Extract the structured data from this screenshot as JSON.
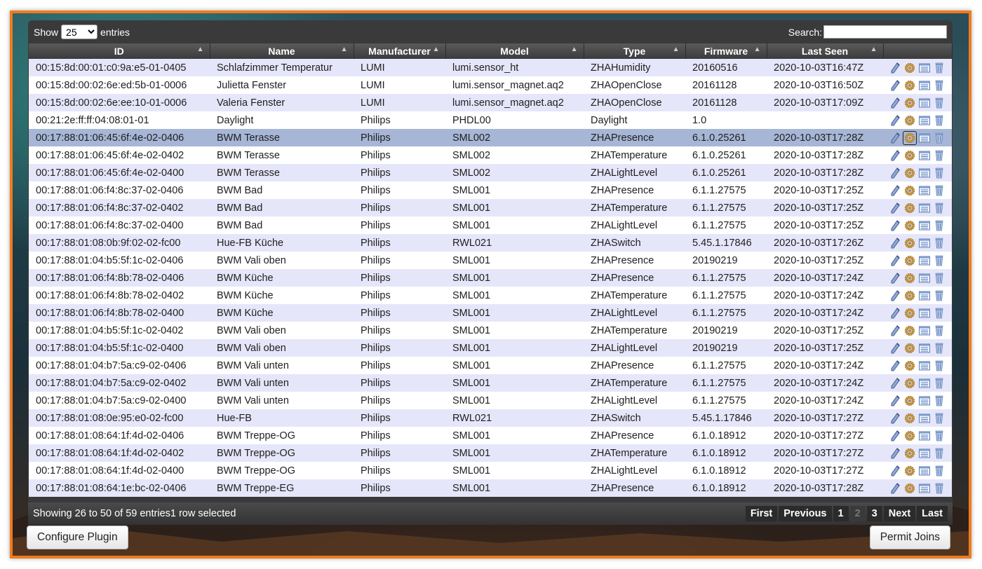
{
  "toolbar": {
    "show_label": "Show",
    "entries_value": "25",
    "entries_label": "entries",
    "search_label": "Search:",
    "search_value": ""
  },
  "columns": [
    "ID",
    "Name",
    "Manufacturer",
    "Model",
    "Type",
    "Firmware",
    "Last Seen",
    ""
  ],
  "rows": [
    [
      "00:15:8d:00:01:c0:9a:e5-01-0405",
      "Schlafzimmer Temperatur",
      "LUMI",
      "lumi.sensor_ht",
      "ZHAHumidity",
      "20160516",
      "2020-10-03T16:47Z"
    ],
    [
      "00:15:8d:00:02:6e:ed:5b-01-0006",
      "Julietta Fenster",
      "LUMI",
      "lumi.sensor_magnet.aq2",
      "ZHAOpenClose",
      "20161128",
      "2020-10-03T16:50Z"
    ],
    [
      "00:15:8d:00:02:6e:ee:10-01-0006",
      "Valeria Fenster",
      "LUMI",
      "lumi.sensor_magnet.aq2",
      "ZHAOpenClose",
      "20161128",
      "2020-10-03T17:09Z"
    ],
    [
      "00:21:2e:ff:ff:04:08:01-01",
      "Daylight",
      "Philips",
      "PHDL00",
      "Daylight",
      "1.0",
      ""
    ],
    [
      "00:17:88:01:06:45:6f:4e-02-0406",
      "BWM Terasse",
      "Philips",
      "SML002",
      "ZHAPresence",
      "6.1.0.25261",
      "2020-10-03T17:28Z"
    ],
    [
      "00:17:88:01:06:45:6f:4e-02-0402",
      "BWM Terasse",
      "Philips",
      "SML002",
      "ZHATemperature",
      "6.1.0.25261",
      "2020-10-03T17:28Z"
    ],
    [
      "00:17:88:01:06:45:6f:4e-02-0400",
      "BWM Terasse",
      "Philips",
      "SML002",
      "ZHALightLevel",
      "6.1.0.25261",
      "2020-10-03T17:28Z"
    ],
    [
      "00:17:88:01:06:f4:8c:37-02-0406",
      "BWM Bad",
      "Philips",
      "SML001",
      "ZHAPresence",
      "6.1.1.27575",
      "2020-10-03T17:25Z"
    ],
    [
      "00:17:88:01:06:f4:8c:37-02-0402",
      "BWM Bad",
      "Philips",
      "SML001",
      "ZHATemperature",
      "6.1.1.27575",
      "2020-10-03T17:25Z"
    ],
    [
      "00:17:88:01:06:f4:8c:37-02-0400",
      "BWM Bad",
      "Philips",
      "SML001",
      "ZHALightLevel",
      "6.1.1.27575",
      "2020-10-03T17:25Z"
    ],
    [
      "00:17:88:01:08:0b:9f:02-02-fc00",
      "Hue-FB Küche",
      "Philips",
      "RWL021",
      "ZHASwitch",
      "5.45.1.17846",
      "2020-10-03T17:26Z"
    ],
    [
      "00:17:88:01:04:b5:5f:1c-02-0406",
      "BWM Vali oben",
      "Philips",
      "SML001",
      "ZHAPresence",
      "20190219",
      "2020-10-03T17:25Z"
    ],
    [
      "00:17:88:01:06:f4:8b:78-02-0406",
      "BWM Küche",
      "Philips",
      "SML001",
      "ZHAPresence",
      "6.1.1.27575",
      "2020-10-03T17:24Z"
    ],
    [
      "00:17:88:01:06:f4:8b:78-02-0402",
      "BWM Küche",
      "Philips",
      "SML001",
      "ZHATemperature",
      "6.1.1.27575",
      "2020-10-03T17:24Z"
    ],
    [
      "00:17:88:01:06:f4:8b:78-02-0400",
      "BWM Küche",
      "Philips",
      "SML001",
      "ZHALightLevel",
      "6.1.1.27575",
      "2020-10-03T17:24Z"
    ],
    [
      "00:17:88:01:04:b5:5f:1c-02-0402",
      "BWM Vali oben",
      "Philips",
      "SML001",
      "ZHATemperature",
      "20190219",
      "2020-10-03T17:25Z"
    ],
    [
      "00:17:88:01:04:b5:5f:1c-02-0400",
      "BWM Vali oben",
      "Philips",
      "SML001",
      "ZHALightLevel",
      "20190219",
      "2020-10-03T17:25Z"
    ],
    [
      "00:17:88:01:04:b7:5a:c9-02-0406",
      "BWM Vali unten",
      "Philips",
      "SML001",
      "ZHAPresence",
      "6.1.1.27575",
      "2020-10-03T17:24Z"
    ],
    [
      "00:17:88:01:04:b7:5a:c9-02-0402",
      "BWM Vali unten",
      "Philips",
      "SML001",
      "ZHATemperature",
      "6.1.1.27575",
      "2020-10-03T17:24Z"
    ],
    [
      "00:17:88:01:04:b7:5a:c9-02-0400",
      "BWM Vali unten",
      "Philips",
      "SML001",
      "ZHALightLevel",
      "6.1.1.27575",
      "2020-10-03T17:24Z"
    ],
    [
      "00:17:88:01:08:0e:95:e0-02-fc00",
      "Hue-FB",
      "Philips",
      "RWL021",
      "ZHASwitch",
      "5.45.1.17846",
      "2020-10-03T17:27Z"
    ],
    [
      "00:17:88:01:08:64:1f:4d-02-0406",
      "BWM Treppe-OG",
      "Philips",
      "SML001",
      "ZHAPresence",
      "6.1.0.18912",
      "2020-10-03T17:27Z"
    ],
    [
      "00:17:88:01:08:64:1f:4d-02-0402",
      "BWM Treppe-OG",
      "Philips",
      "SML001",
      "ZHATemperature",
      "6.1.0.18912",
      "2020-10-03T17:27Z"
    ],
    [
      "00:17:88:01:08:64:1f:4d-02-0400",
      "BWM Treppe-OG",
      "Philips",
      "SML001",
      "ZHALightLevel",
      "6.1.0.18912",
      "2020-10-03T17:27Z"
    ],
    [
      "00:17:88:01:08:64:1e:bc-02-0406",
      "BWM Treppe-EG",
      "Philips",
      "SML001",
      "ZHAPresence",
      "6.1.0.18912",
      "2020-10-03T17:28Z"
    ]
  ],
  "selected_row_index": 4,
  "row_action_icons": [
    "pencil-icon",
    "gear-icon",
    "list-icon",
    "trash-icon"
  ],
  "footer": {
    "info": "Showing 26 to 50 of 59 entries1 row selected",
    "pager": [
      "First",
      "Previous",
      "1",
      "2",
      "3",
      "Next",
      "Last"
    ],
    "current_page": "2"
  },
  "buttons": {
    "configure": "Configure Plugin",
    "permit": "Permit Joins"
  },
  "colors": {
    "frame_border": "#f07b1d",
    "row_odd": "#e6e6fa",
    "row_selected": "#a7b6d6",
    "header_bg": "#4a4a4a"
  }
}
